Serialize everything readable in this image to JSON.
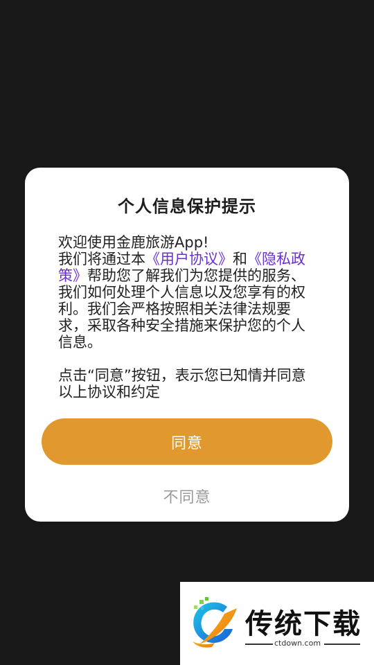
{
  "dialog": {
    "title": "个人信息保护提示",
    "welcome": "欢迎使用金鹿旅游App!",
    "para1_prefix": "我们将通过本",
    "user_agreement_link": "《用户协议》",
    "and_text": "和",
    "privacy_policy_link": "《隐私政策》",
    "para1_suffix": "帮助您了解我们为您提供的服务、我们如何处理个人信息以及您享有的权利。我们会严格按照相关法律法规要求，采取各种安全措施来保护您的个人信息。",
    "para2": "点击“同意”按钮，表示您已知情并同意以上协议和约定",
    "agree_label": "同意",
    "disagree_label": "不同意"
  },
  "watermark": {
    "brand": "传统下载",
    "domain": "ctdown.com"
  },
  "colors": {
    "background": "#181818",
    "accent": "#e0982f",
    "link": "#6a2fd0"
  }
}
